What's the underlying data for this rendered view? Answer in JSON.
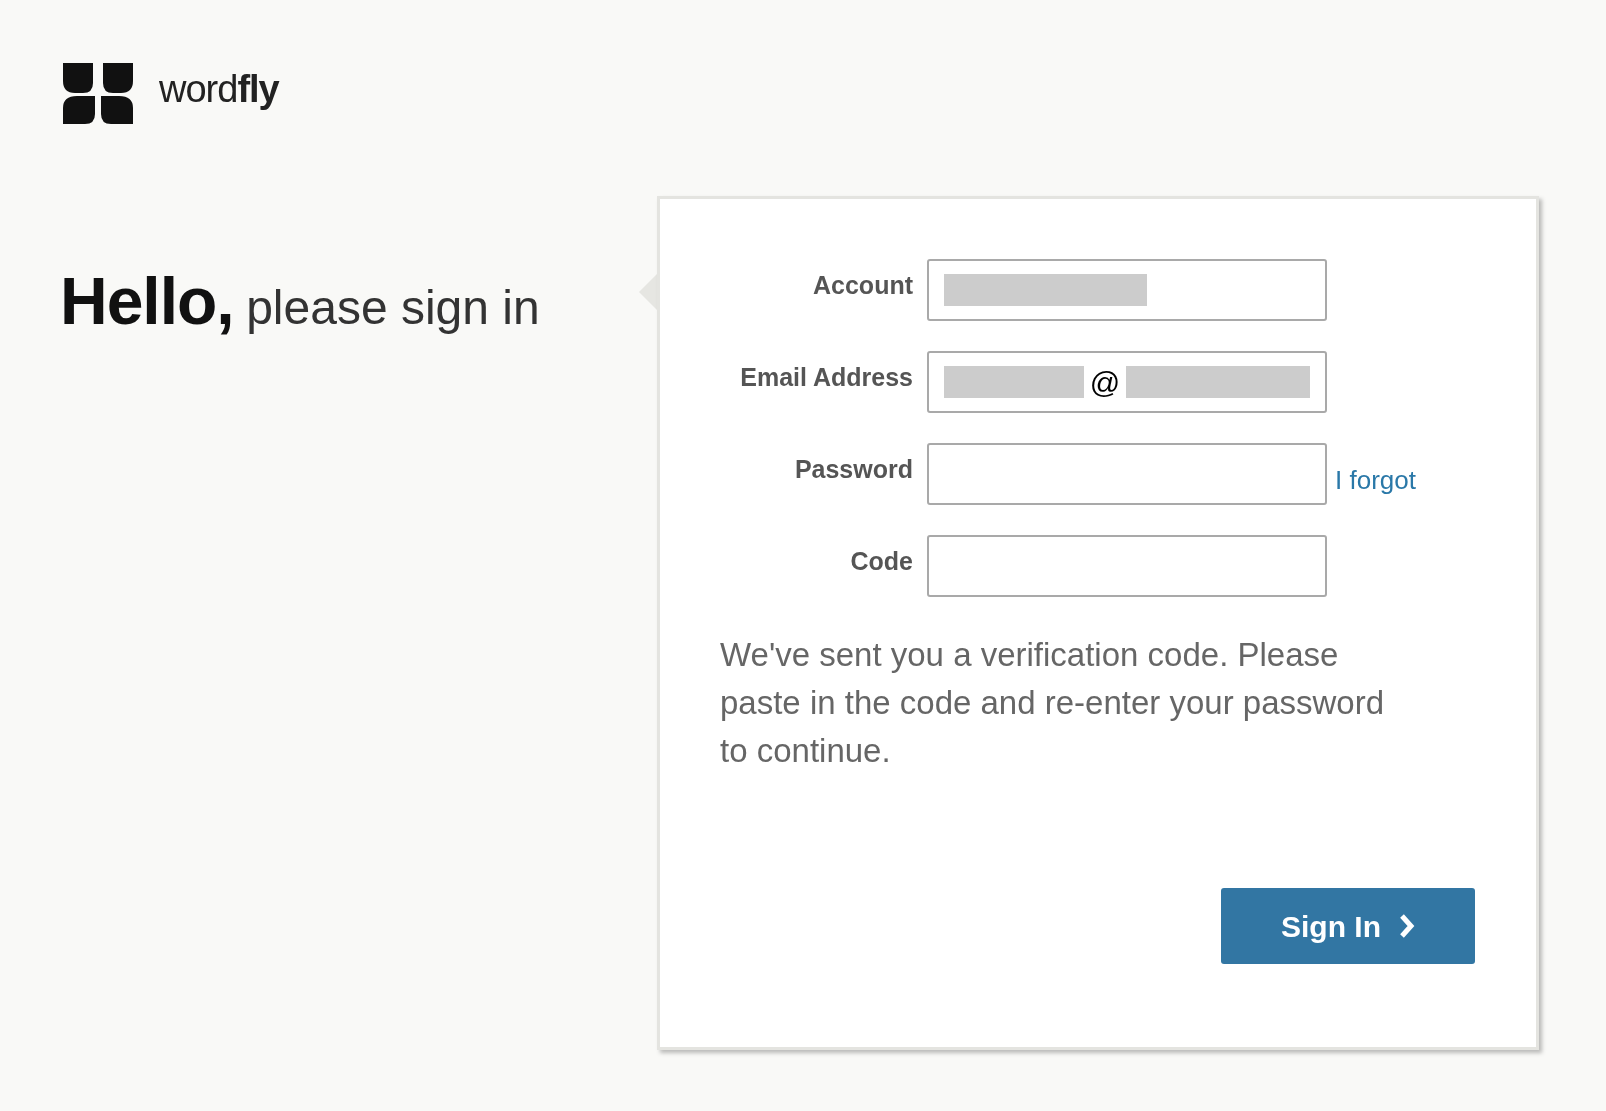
{
  "brand": {
    "name": "word**fly**"
  },
  "heading": {
    "strong": "Hello,",
    "rest": "please sign in"
  },
  "form": {
    "fields": [
      {
        "label": "Account",
        "redacted": true
      },
      {
        "label": "Email Address",
        "redacted": true,
        "separator": "@"
      },
      {
        "label": "Password",
        "redacted": false,
        "link": "I forgot"
      },
      {
        "label": "Code",
        "redacted": false
      }
    ],
    "message": "We've sent you a verification code. Please paste in the code and re-enter your password to continue.",
    "submit": "Sign In"
  }
}
